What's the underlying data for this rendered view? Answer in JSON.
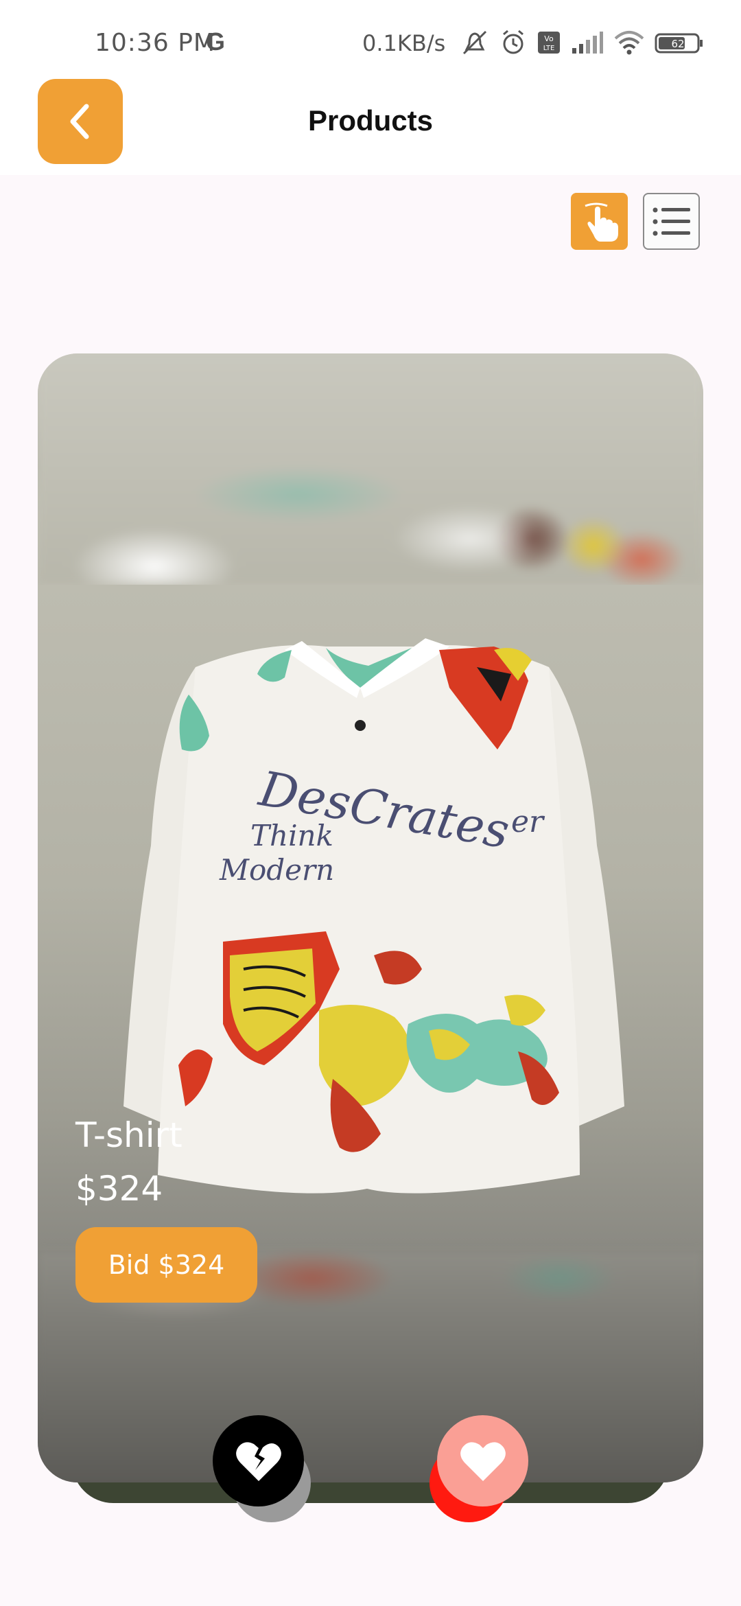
{
  "status_bar": {
    "time": "10:36 PM",
    "carrier_icon": "G",
    "network_speed": "0.1KB/s",
    "battery_level": "62",
    "icons": [
      "mute-icon",
      "alarm-icon",
      "volte-icon",
      "signal-icon",
      "wifi-icon",
      "battery-icon"
    ]
  },
  "app_bar": {
    "title": "Products",
    "back_icon": "chevron-left-icon"
  },
  "view_toggle": {
    "swipe_icon": "swipe-hand-icon",
    "list_icon": "list-icon",
    "active": "swipe"
  },
  "product": {
    "name": "T-shirt",
    "price": "$324",
    "bid_label": "Bid $324",
    "image_text": [
      "DesCrates",
      "Think",
      "Modern"
    ]
  },
  "actions": {
    "dislike_icon": "broken-heart-icon",
    "like_icon": "heart-icon"
  },
  "colors": {
    "accent": "#f0a035",
    "like": "#fa9f95",
    "dislike": "#000000",
    "background": "#fdf8fb"
  }
}
